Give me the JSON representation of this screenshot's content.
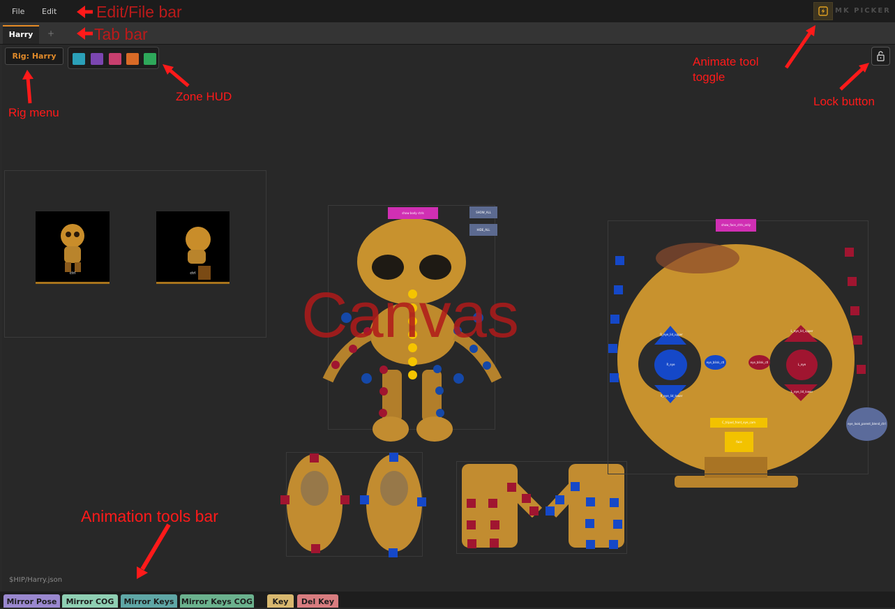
{
  "menubar": {
    "file": "File",
    "edit": "Edit",
    "app_label": "MK PICKER"
  },
  "tabbar": {
    "active_tab": "Harry",
    "add_tab": "+"
  },
  "toolbar": {
    "rig_menu_label": "Rig: Harry",
    "zone_colors": [
      "#2ba0b8",
      "#7b46b0",
      "#c83f6e",
      "#d86a26",
      "#2ea85a"
    ]
  },
  "annotations": {
    "edit_file_bar": "Edit/File bar",
    "tab_bar": "Tab bar",
    "rig_menu": "Rig menu",
    "zone_hud": "Zone HUD",
    "animate_toggle": "Animate tool toggle",
    "lock_button": "Lock button",
    "canvas": "Canvas",
    "animation_tools_bar": "Animation tools bar"
  },
  "canvas": {
    "thumbnails": [
      "ctrl",
      "ctrl"
    ],
    "body_buttons": {
      "show_body": "show body ctrls",
      "show_all": "SHOW_ALL",
      "hide_all": "HIDE_ALL"
    },
    "face_buttons": {
      "show_face": "show_face_ctrls_only",
      "r_eye": "R_eye",
      "l_eye": "L_eye",
      "r_lid_upper": "R_eye_lid_upper",
      "r_lid_lower": "R_eye_lid_lower",
      "l_lid_upper": "L_eye_lid_upper",
      "l_lid_lower": "L_eye_lid_lower",
      "eye_blink_r": "eye_blink_ctl",
      "eye_blink_l": "eye_blink_ctl",
      "tripod": "C_tripod_front_eye_cam",
      "face": "face",
      "look_blend": "eye_look_parent_blend_ctrl"
    },
    "file_path": "$HIP/Harry.json"
  },
  "anim_tools": [
    {
      "label": "Mirror Pose",
      "color": "#9a88cf"
    },
    {
      "label": "Mirror COG",
      "color": "#8fcfb3"
    },
    {
      "label": "Mirror Keys",
      "color": "#5fa7a6"
    },
    {
      "label": "Mirror Keys COG",
      "color": "#6bb28e"
    },
    {
      "label": "Key",
      "color": "#d8b86f"
    },
    {
      "label": "Del Key",
      "color": "#d87d80"
    }
  ]
}
